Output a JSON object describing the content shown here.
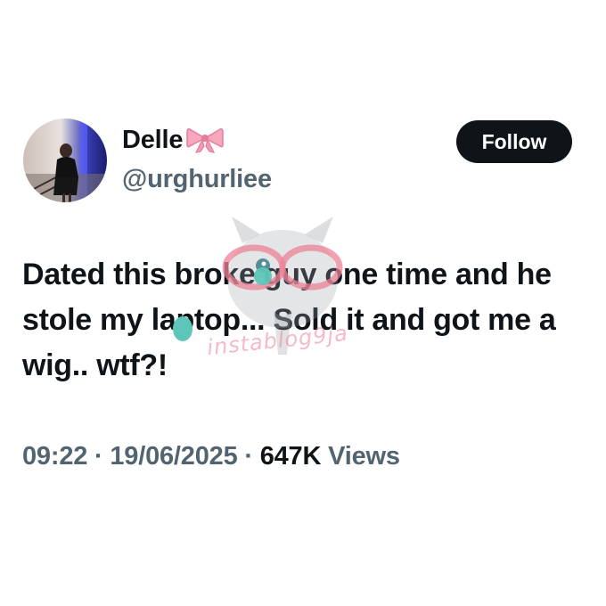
{
  "user": {
    "display_name": "Delle",
    "handle": "@urghurliee",
    "name_emoji": "ribbon-bow-icon"
  },
  "actions": {
    "follow_label": "Follow"
  },
  "tweet": {
    "text": "Dated this broke guy one time and he stole my laptop... Sold it and got me a wig.. wtf?!"
  },
  "meta": {
    "time": "09:22",
    "separator": "·",
    "date": "19/06/2025",
    "views_count": "647K",
    "views_label": "Views"
  },
  "watermark": {
    "text": "instablog9ja"
  },
  "colors": {
    "primary_text": "#0f1419",
    "secondary_text": "#536471",
    "button_bg": "#0f1419",
    "button_text": "#ffffff",
    "watermark_pink": "#ec8296",
    "watermark_teal": "#5ec6b8"
  }
}
